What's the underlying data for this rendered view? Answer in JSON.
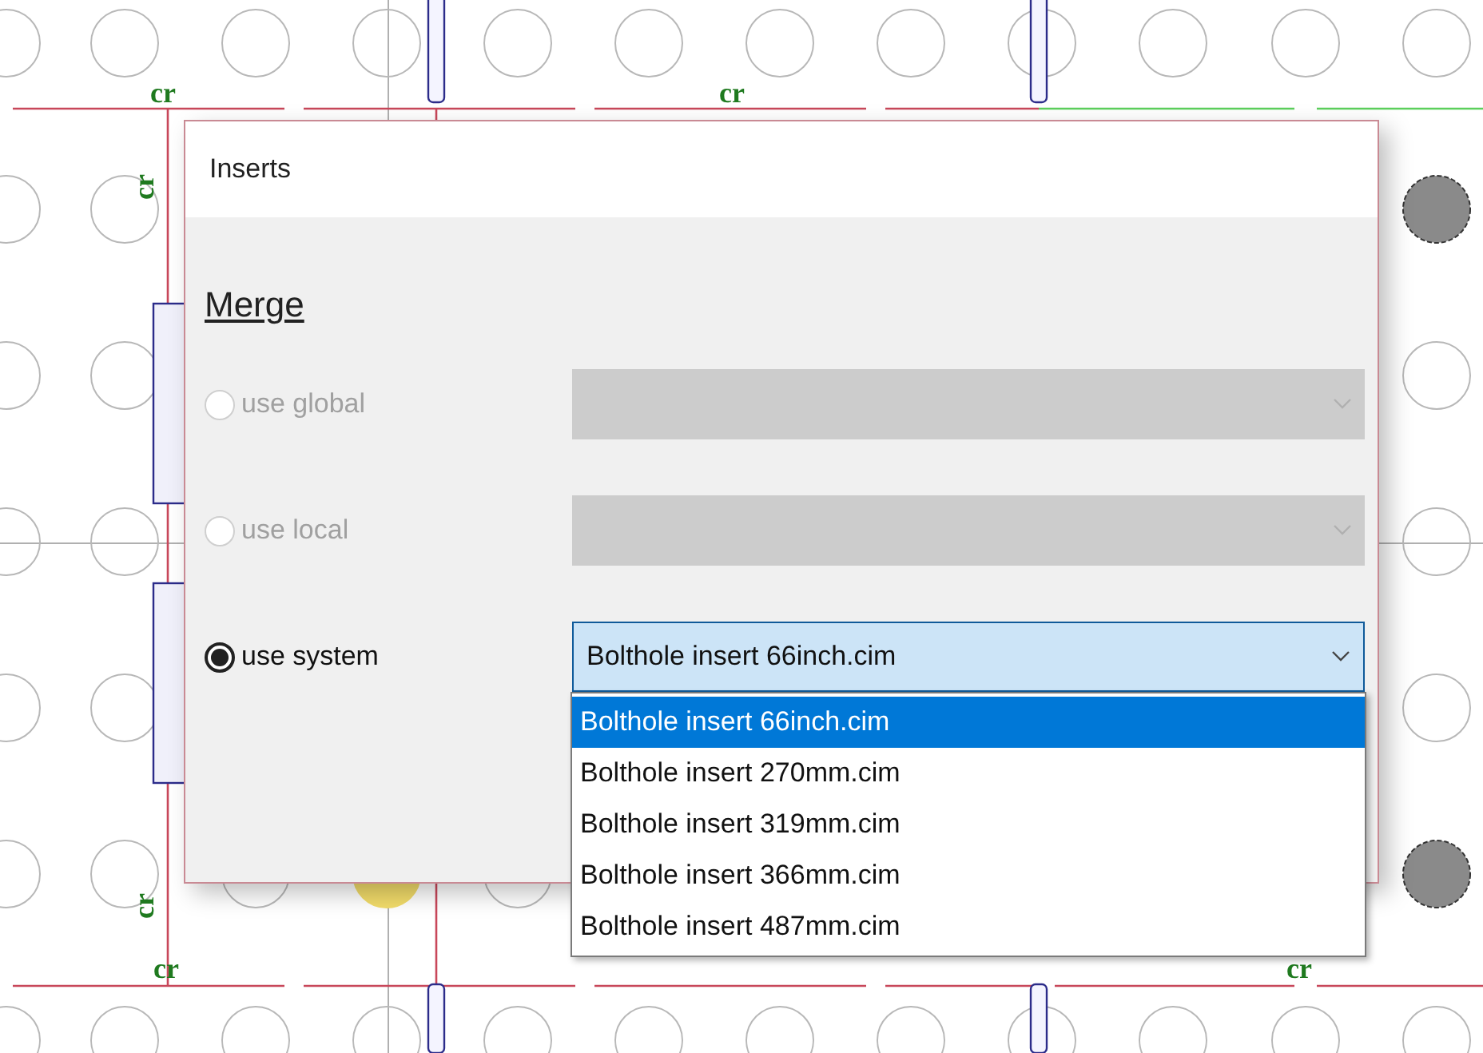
{
  "canvas": {
    "labels": [
      {
        "text": "cr",
        "kind": "horizontal"
      },
      {
        "text": "cr",
        "kind": "horizontal"
      },
      {
        "text": "cr",
        "kind": "vertical"
      },
      {
        "text": "cr",
        "kind": "vertical"
      },
      {
        "text": "cr",
        "kind": "horizontal"
      },
      {
        "text": "cr",
        "kind": "horizontal"
      }
    ]
  },
  "dialog": {
    "title": "Inserts",
    "section": "Merge",
    "options": [
      {
        "label": "use global",
        "selected": false,
        "disabled": true
      },
      {
        "label": "use local",
        "selected": false,
        "disabled": true
      },
      {
        "label": "use system",
        "selected": true,
        "disabled": false,
        "value": "Bolthole insert 66inch.cim"
      }
    ],
    "dropdown_items": [
      {
        "label": "Bolthole insert 66inch.cim",
        "selected": true
      },
      {
        "label": "Bolthole insert 270mm.cim",
        "selected": false
      },
      {
        "label": "Bolthole insert 319mm.cim",
        "selected": false
      },
      {
        "label": "Bolthole insert 366mm.cim",
        "selected": false
      },
      {
        "label": "Bolthole insert 487mm.cim",
        "selected": false
      }
    ]
  }
}
